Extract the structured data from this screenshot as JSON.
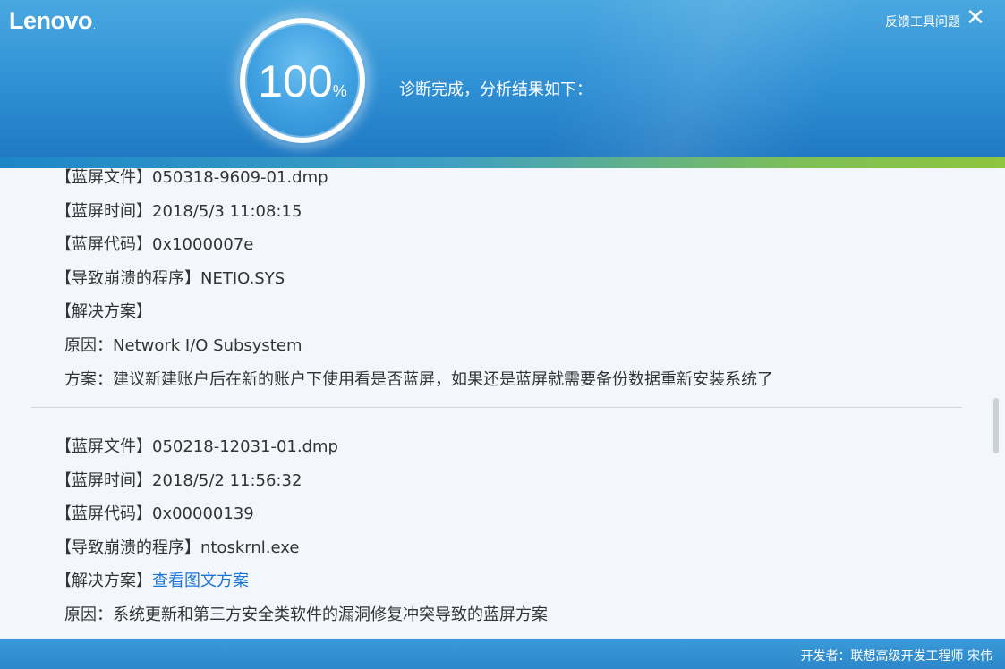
{
  "header": {
    "logo": "Lenovo",
    "logo_mark": ".",
    "feedback": "反馈工具问题",
    "close_glyph": "✕",
    "progress": {
      "value": "100",
      "symbol": "%"
    },
    "status": "诊断完成，分析结果如下："
  },
  "entries": [
    {
      "file_label": "【蓝屏文件】",
      "file": "050318-9609-01.dmp",
      "time_label": "【蓝屏时间】",
      "time": "2018/5/3 11:08:15",
      "code_label": "【蓝屏代码】",
      "code": "0x1000007e",
      "program_label": "【导致崩溃的程序】",
      "program": "NETIO.SYS",
      "solution_label": "【解决方案】",
      "reason_label": "原因：",
      "reason": "Network I/O Subsystem",
      "plan_label": "方案：",
      "plan": "建议新建账户后在新的账户下使用看是否蓝屏，如果还是蓝屏就需要备份数据重新安装系统了"
    },
    {
      "file_label": "【蓝屏文件】",
      "file": "050218-12031-01.dmp",
      "time_label": "【蓝屏时间】",
      "time": "2018/5/2 11:56:32",
      "code_label": "【蓝屏代码】",
      "code": "0x00000139",
      "program_label": "【导致崩溃的程序】",
      "program": "ntoskrnl.exe",
      "solution_label": "【解决方案】",
      "solution_link": "查看图文方案",
      "reason_label": "原因：",
      "reason": "系统更新和第三方安全类软件的漏洞修复冲突导致的蓝屏方案"
    }
  ],
  "footer": {
    "developer": "开发者：联想高级开发工程师 宋伟"
  },
  "colors": {
    "header": "#2f8fd4",
    "accent_green": "#8ec53d",
    "link": "#1a73d9",
    "body_bg": "#f3f7fc"
  }
}
